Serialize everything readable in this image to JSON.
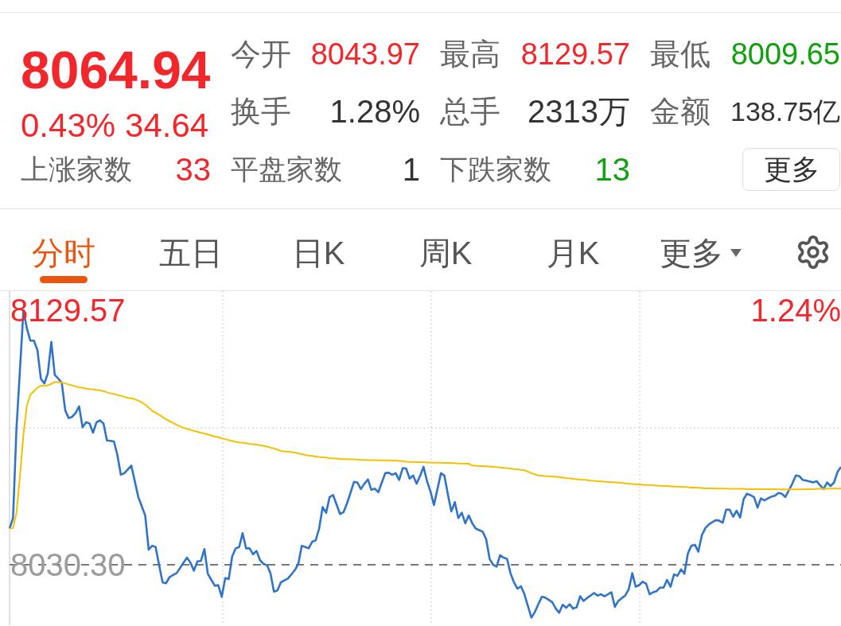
{
  "quote": {
    "price": "8064.94",
    "change_percent": "0.43%",
    "change": "34.64",
    "color": "#f2272b"
  },
  "stats": [
    {
      "label": "今开",
      "value": "8043.97",
      "color": "#f2272b"
    },
    {
      "label": "最高",
      "value": "8129.57",
      "color": "#f2272b"
    },
    {
      "label": "最低",
      "value": "8009.65",
      "color": "#10a010"
    },
    {
      "label": "换手",
      "value": "1.28%",
      "color": "#333333"
    },
    {
      "label": "总手",
      "value": "2313万",
      "color": "#333333"
    },
    {
      "label": "金额",
      "value": "138.75亿",
      "color": "#333333"
    }
  ],
  "breadth": [
    {
      "label": "上涨家数",
      "value": "33",
      "color": "#f2272b"
    },
    {
      "label": "平盘家数",
      "value": "1",
      "color": "#333333"
    },
    {
      "label": "下跌家数",
      "value": "13",
      "color": "#10a010"
    }
  ],
  "more_button": "更多",
  "tabs": [
    {
      "label": "分时",
      "selected": true,
      "kind": "tab"
    },
    {
      "label": "五日",
      "selected": false,
      "kind": "tab"
    },
    {
      "label": "日K",
      "selected": false,
      "kind": "tab"
    },
    {
      "label": "周K",
      "selected": false,
      "kind": "tab"
    },
    {
      "label": "月K",
      "selected": false,
      "kind": "tab"
    },
    {
      "label": "更多",
      "selected": false,
      "kind": "dropdown"
    }
  ],
  "chart": {
    "percent_label": "1.24%",
    "chart_data": {
      "type": "line",
      "categories": [
        null,
        null,
        null,
        null,
        null,
        null,
        null,
        null,
        null,
        null,
        null,
        null,
        null,
        null,
        null,
        null,
        null,
        null,
        null,
        null,
        null,
        null,
        null,
        null,
        null,
        null,
        null,
        null,
        null,
        null,
        null,
        null,
        null,
        null,
        null,
        null,
        null,
        null,
        null,
        null,
        null,
        null,
        null,
        null,
        null,
        null,
        null,
        null,
        null,
        null,
        null,
        null,
        null,
        null,
        null,
        null,
        null,
        null,
        null,
        null,
        null,
        null,
        null,
        null,
        null,
        null,
        null,
        null,
        null,
        null,
        null,
        null,
        null,
        null,
        null,
        null,
        null,
        null,
        null,
        null,
        null,
        null,
        null,
        null,
        null,
        null,
        null,
        null,
        null,
        null,
        null,
        null,
        null,
        null,
        null,
        null,
        null,
        null,
        null,
        null,
        null,
        null,
        null,
        null,
        null,
        null,
        null,
        null,
        null,
        null,
        null,
        null,
        null,
        null,
        null,
        null,
        null,
        null,
        null,
        null,
        null,
        null,
        null,
        null,
        null,
        null,
        null,
        null,
        null,
        null,
        null,
        null,
        null,
        null,
        null,
        null,
        null,
        null,
        null,
        null,
        null,
        null,
        null,
        null,
        null,
        null,
        null,
        null,
        null,
        null,
        null,
        null,
        null,
        null,
        null,
        null,
        null,
        null,
        null,
        null,
        null,
        null,
        null,
        null,
        null,
        null,
        null,
        null,
        null,
        null,
        null,
        null,
        null,
        null,
        null,
        null,
        null,
        null,
        null,
        null,
        null,
        null,
        null,
        null,
        null,
        null,
        null,
        null,
        null,
        null,
        null,
        null,
        null,
        null,
        null,
        null,
        null,
        null,
        null,
        null,
        null,
        null,
        null,
        null,
        null,
        null,
        null,
        null,
        null,
        null,
        null,
        null,
        null,
        null,
        null,
        null,
        null,
        null,
        null,
        null,
        null,
        null,
        null,
        null,
        null,
        null,
        null,
        null,
        null,
        null,
        null,
        null,
        null,
        null,
        null,
        null,
        null,
        null,
        null,
        null
      ],
      "ylim": [
        8006.72,
        8137.02
      ],
      "yticks": [
        {
          "value": 8129.57,
          "label": "8129.57"
        },
        {
          "value": 8030.3,
          "label": "8030.30"
        }
      ],
      "ref_lines": [
        {
          "axis": "y",
          "value": 8030.3
        }
      ],
      "series": [
        {
          "color": "#2f74c8",
          "values": [
            8044.4,
            8048.5,
            8083.4,
            8106.5,
            8129.6,
            8122.3,
            8117.7,
            8117.7,
            8114.1,
            8102.8,
            8101.0,
            8104.9,
            8117.2,
            8104.4,
            8102.9,
            8101.3,
            8090.5,
            8087.5,
            8088.0,
            8089.5,
            8092.1,
            8083.9,
            8085.9,
            8085.4,
            8081.8,
            8085.9,
            8086.6,
            8085.4,
            8078.8,
            8078.6,
            8078.4,
            8073.1,
            8065.4,
            8066.0,
            8067.5,
            8069.0,
            8062.9,
            8056.7,
            8053.1,
            8049.5,
            8036.2,
            8037.7,
            8037.2,
            8030.1,
            8023.4,
            8023.1,
            8025.5,
            8026.3,
            8027.0,
            8029.0,
            8031.1,
            8033.1,
            8031.1,
            8028.0,
            8031.6,
            8031.8,
            8036.4,
            8026.8,
            8024.4,
            8022.1,
            8022.4,
            8017.8,
            8025.1,
            8024.7,
            8033.6,
            8036.7,
            8037.2,
            8042.6,
            8036.7,
            8036.7,
            8034.4,
            8035.7,
            8032.1,
            8030.6,
            8030.1,
            8027.0,
            8019.8,
            8020.3,
            8023.4,
            8024.2,
            8024.9,
            8026.5,
            8028.2,
            8030.6,
            8037.7,
            8037.2,
            8036.7,
            8039.3,
            8039.8,
            8044.4,
            8052.8,
            8050.6,
            8056.7,
            8057.5,
            8053.8,
            8050.1,
            8050.8,
            8054.2,
            8058.3,
            8062.6,
            8062.4,
            8059.8,
            8061.9,
            8063.6,
            8059.5,
            8060.0,
            8058.6,
            8062.3,
            8066.0,
            8066.2,
            8065.4,
            8066.0,
            8063.4,
            8068.0,
            8067.8,
            8063.9,
            8065.1,
            8061.9,
            8064.9,
            8068.5,
            8062.9,
            8058.8,
            8053.6,
            8059.8,
            8066.0,
            8065.1,
            8057.8,
            8051.1,
            8054.7,
            8048.5,
            8050.6,
            8046.5,
            8049.5,
            8046.5,
            8044.4,
            8043.8,
            8043.2,
            8040.3,
            8032.6,
            8030.3,
            8029.6,
            8034.0,
            8033.1,
            8032.6,
            8027.0,
            8023.4,
            8021.0,
            8021.9,
            8018.8,
            8014.2,
            8009.7,
            8011.8,
            8014.9,
            8017.8,
            8017.5,
            8016.6,
            8015.7,
            8013.2,
            8011.6,
            8014.7,
            8013.5,
            8014.9,
            8013.2,
            8013.7,
            8018.0,
            8016.2,
            8017.3,
            8018.3,
            8019.3,
            8018.3,
            8018.8,
            8018.0,
            8018.8,
            8019.6,
            8013.9,
            8016.2,
            8017.3,
            8018.3,
            8020.8,
            8027.0,
            8021.7,
            8022.4,
            8023.7,
            8022.9,
            8018.8,
            8019.6,
            8020.0,
            8021.4,
            8021.4,
            8024.4,
            8021.7,
            8026.5,
            8026.0,
            8028.5,
            8026.8,
            8034.7,
            8037.7,
            8038.1,
            8035.4,
            8041.8,
            8044.6,
            8046.0,
            8046.9,
            8047.7,
            8047.5,
            8046.7,
            8051.8,
            8051.8,
            8049.0,
            8051.4,
            8048.7,
            8055.9,
            8058.0,
            8057.4,
            8056.7,
            8052.6,
            8056.2,
            8055.4,
            8056.2,
            8056.9,
            8057.2,
            8058.3,
            8058.0,
            8056.7,
            8059.3,
            8061.9,
            8065.1,
            8064.9,
            8063.4,
            8063.1,
            8062.8,
            8062.4,
            8062.9,
            8061.3,
            8059.8,
            8062.4,
            8061.0,
            8062.4,
            8066.5,
            8068.5
          ]
        },
        {
          "color": "#f5c000",
          "values": [
            8044.4,
            8044.6,
            8050.6,
            8064.9,
            8081.3,
            8092.6,
            8096.7,
            8098.0,
            8099.3,
            8100.1,
            8100.2,
            8100.3,
            8100.8,
            8101.6,
            8101.5,
            8101.3,
            8101.0,
            8100.6,
            8100.3,
            8099.9,
            8099.5,
            8099.3,
            8099.0,
            8098.8,
            8098.7,
            8098.5,
            8098.3,
            8098.0,
            8097.6,
            8097.2,
            8096.9,
            8096.5,
            8096.2,
            8095.8,
            8095.4,
            8095.2,
            8094.9,
            8094.3,
            8093.6,
            8092.8,
            8091.6,
            8090.3,
            8089.6,
            8088.8,
            8087.9,
            8087.0,
            8086.3,
            8085.6,
            8084.9,
            8084.3,
            8083.7,
            8083.3,
            8082.9,
            8082.5,
            8082.2,
            8081.8,
            8081.5,
            8081.1,
            8080.7,
            8080.3,
            8080.0,
            8079.6,
            8079.3,
            8078.9,
            8078.6,
            8078.2,
            8078.0,
            8077.9,
            8077.7,
            8077.5,
            8077.3,
            8077.1,
            8076.9,
            8076.7,
            8076.4,
            8076.0,
            8075.7,
            8075.2,
            8074.7,
            8074.5,
            8074.4,
            8074.2,
            8074.0,
            8073.7,
            8073.4,
            8073.1,
            8072.9,
            8072.7,
            8072.5,
            8072.3,
            8072.2,
            8072.1,
            8071.9,
            8071.8,
            8071.7,
            8071.6,
            8071.5,
            8071.5,
            8071.4,
            8071.4,
            8071.3,
            8071.2,
            8071.2,
            8071.1,
            8071.1,
            8071.1,
            8071.0,
            8071.0,
            8071.0,
            8071.0,
            8070.9,
            8070.9,
            8070.8,
            8070.7,
            8070.5,
            8070.4,
            8070.4,
            8070.3,
            8070.3,
            8070.3,
            8070.2,
            8070.2,
            8070.1,
            8070.1,
            8070.1,
            8070.0,
            8070.0,
            8069.9,
            8069.9,
            8069.8,
            8069.8,
            8069.7,
            8069.7,
            8069.0,
            8068.9,
            8068.8,
            8068.8,
            8068.7,
            8068.6,
            8068.5,
            8068.4,
            8068.2,
            8068.1,
            8068.0,
            8067.8,
            8067.6,
            8067.5,
            8067.3,
            8067.2,
            8066.6,
            8066.0,
            8065.6,
            8065.1,
            8065.0,
            8064.9,
            8064.8,
            8064.7,
            8064.6,
            8064.5,
            8064.3,
            8064.1,
            8064.0,
            8063.8,
            8063.7,
            8063.5,
            8063.4,
            8063.3,
            8063.1,
            8063.0,
            8062.9,
            8062.8,
            8062.7,
            8062.6,
            8062.5,
            8062.4,
            8062.3,
            8062.2,
            8062.0,
            8061.9,
            8061.8,
            8061.7,
            8061.6,
            8061.5,
            8061.4,
            8061.4,
            8061.3,
            8061.2,
            8061.1,
            8061.0,
            8061.0,
            8060.9,
            8060.8,
            8060.8,
            8060.7,
            8060.6,
            8060.5,
            8060.4,
            8060.4,
            8060.3,
            8060.2,
            8060.1,
            8060.1,
            8060.1,
            8060.0,
            8060.0,
            8060.0,
            8060.0,
            8059.9,
            8059.9,
            8059.9,
            8059.9,
            8059.9,
            8059.8,
            8059.8,
            8059.8,
            8059.8,
            8059.8,
            8059.8,
            8059.8,
            8059.8,
            8059.8,
            8059.7,
            8059.7,
            8059.7,
            8059.7,
            8059.7,
            8059.7,
            8059.7,
            8059.7,
            8059.8,
            8059.8,
            8059.8,
            8059.9,
            8059.9,
            8059.9,
            8059.9,
            8060.0,
            8060.0,
            8060.0,
            8060.0
          ]
        }
      ]
    }
  }
}
